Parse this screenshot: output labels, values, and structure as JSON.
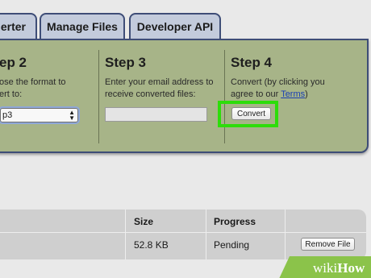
{
  "tabs": [
    {
      "label": "erter"
    },
    {
      "label": "Manage Files"
    },
    {
      "label": "Developer API"
    }
  ],
  "steps": {
    "step2": {
      "title": "ep 2",
      "desc_line1": "ose the format to",
      "desc_line2": "ert to:",
      "selected_format": "p3"
    },
    "step3": {
      "title": "Step 3",
      "desc_line1": "Enter your email address to",
      "desc_line2": "receive converted files:",
      "email_value": ""
    },
    "step4": {
      "title": "Step 4",
      "desc_line1": "Convert (by clicking you",
      "desc_line2_prefix": "agree to our ",
      "terms_link": "Terms",
      "desc_line2_suffix": ")",
      "convert_label": "Convert"
    }
  },
  "files_table": {
    "headers": {
      "size": "Size",
      "progress": "Progress"
    },
    "rows": [
      {
        "size": "52.8 KB",
        "progress": "Pending",
        "action": "Remove File"
      }
    ]
  },
  "watermark": {
    "wiki": "wiki",
    "how": "How"
  },
  "colors": {
    "panel_bg": "#a7b488",
    "tab_bg": "#c3cbdc",
    "border": "#3e4d77",
    "highlight": "#2ddd0a",
    "link": "#1a3fb4"
  }
}
